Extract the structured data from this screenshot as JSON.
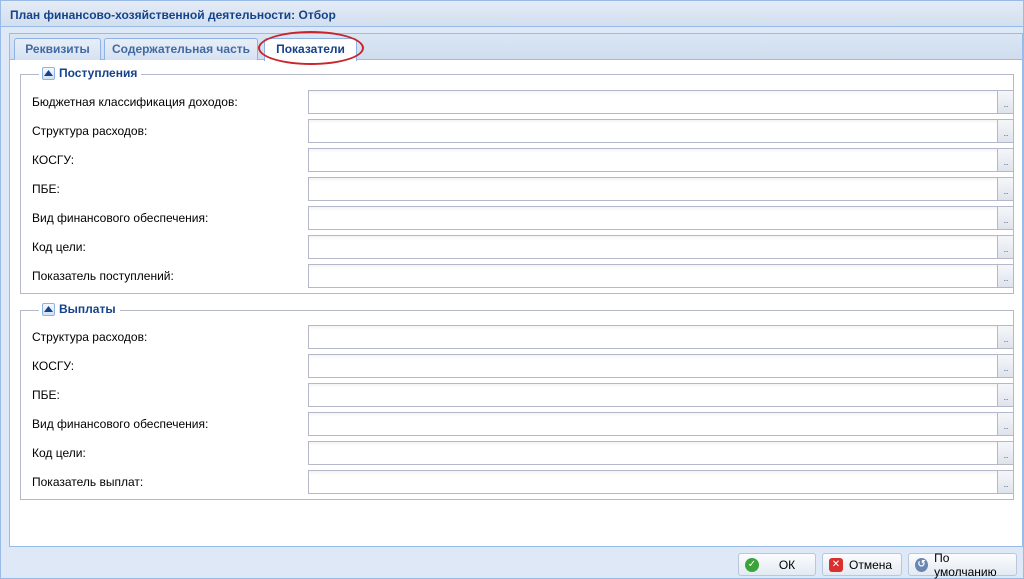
{
  "window": {
    "title": "План финансово-хозяйственной деятельности: Отбор"
  },
  "tabs": [
    {
      "label": "Реквизиты",
      "active": false
    },
    {
      "label": "Содержательная часть",
      "active": false
    },
    {
      "label": "Показатели",
      "active": true
    }
  ],
  "income": {
    "legend": "Поступления",
    "fields": [
      {
        "label": "Бюджетная классификация доходов:",
        "value": ""
      },
      {
        "label": "Структура расходов:",
        "value": ""
      },
      {
        "label": "КОСГУ:",
        "value": ""
      },
      {
        "label": "ПБЕ:",
        "value": ""
      },
      {
        "label": "Вид финансового обеспечения:",
        "value": ""
      },
      {
        "label": "Код цели:",
        "value": ""
      },
      {
        "label": "Показатель поступлений:",
        "value": ""
      }
    ]
  },
  "payments": {
    "legend": "Выплаты",
    "fields": [
      {
        "label": "Структура расходов:",
        "value": ""
      },
      {
        "label": "КОСГУ:",
        "value": ""
      },
      {
        "label": "ПБЕ:",
        "value": ""
      },
      {
        "label": "Вид финансового обеспечения:",
        "value": ""
      },
      {
        "label": "Код цели:",
        "value": ""
      },
      {
        "label": "Показатель выплат:",
        "value": ""
      }
    ]
  },
  "trigger_label": "...",
  "footer": {
    "ok_label": "ОК",
    "cancel_label": "Отмена",
    "default_label": "По умолчанию"
  },
  "colors": {
    "accent": "#15428b",
    "highlight": "#c8262c",
    "ok_icon": "#3aa43a",
    "cancel_icon": "#d9302f",
    "default_icon": "#6a86b3"
  }
}
